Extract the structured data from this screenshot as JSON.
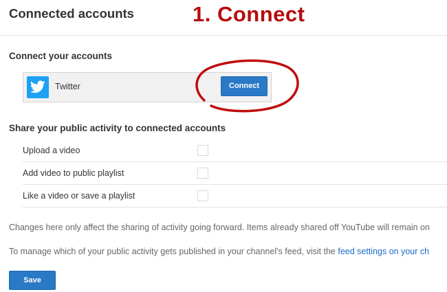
{
  "header": {
    "title": "Connected accounts",
    "annotation": "1. Connect"
  },
  "connect_section": {
    "heading": "Connect your accounts",
    "account": {
      "name": "Twitter",
      "icon": "twitter-bird-icon",
      "button_label": "Connect"
    }
  },
  "share_section": {
    "heading": "Share your public activity to connected accounts",
    "options": [
      {
        "label": "Upload a video",
        "checked": false
      },
      {
        "label": "Add video to public playlist",
        "checked": false
      },
      {
        "label": "Like a video or save a playlist",
        "checked": false
      }
    ]
  },
  "notes": {
    "sharing_note": "Changes here only affect the sharing of activity going forward. Items already shared off YouTube will remain on",
    "manage_note_prefix": "To manage which of your public activity gets published in your channel's feed, visit the ",
    "manage_note_link": "feed settings on your ch"
  },
  "footer": {
    "save_label": "Save"
  },
  "colors": {
    "primary_button": "#2a79c6",
    "annotation": "#b50c0c",
    "twitter": "#1da1f2",
    "link": "#1b6ac9"
  }
}
